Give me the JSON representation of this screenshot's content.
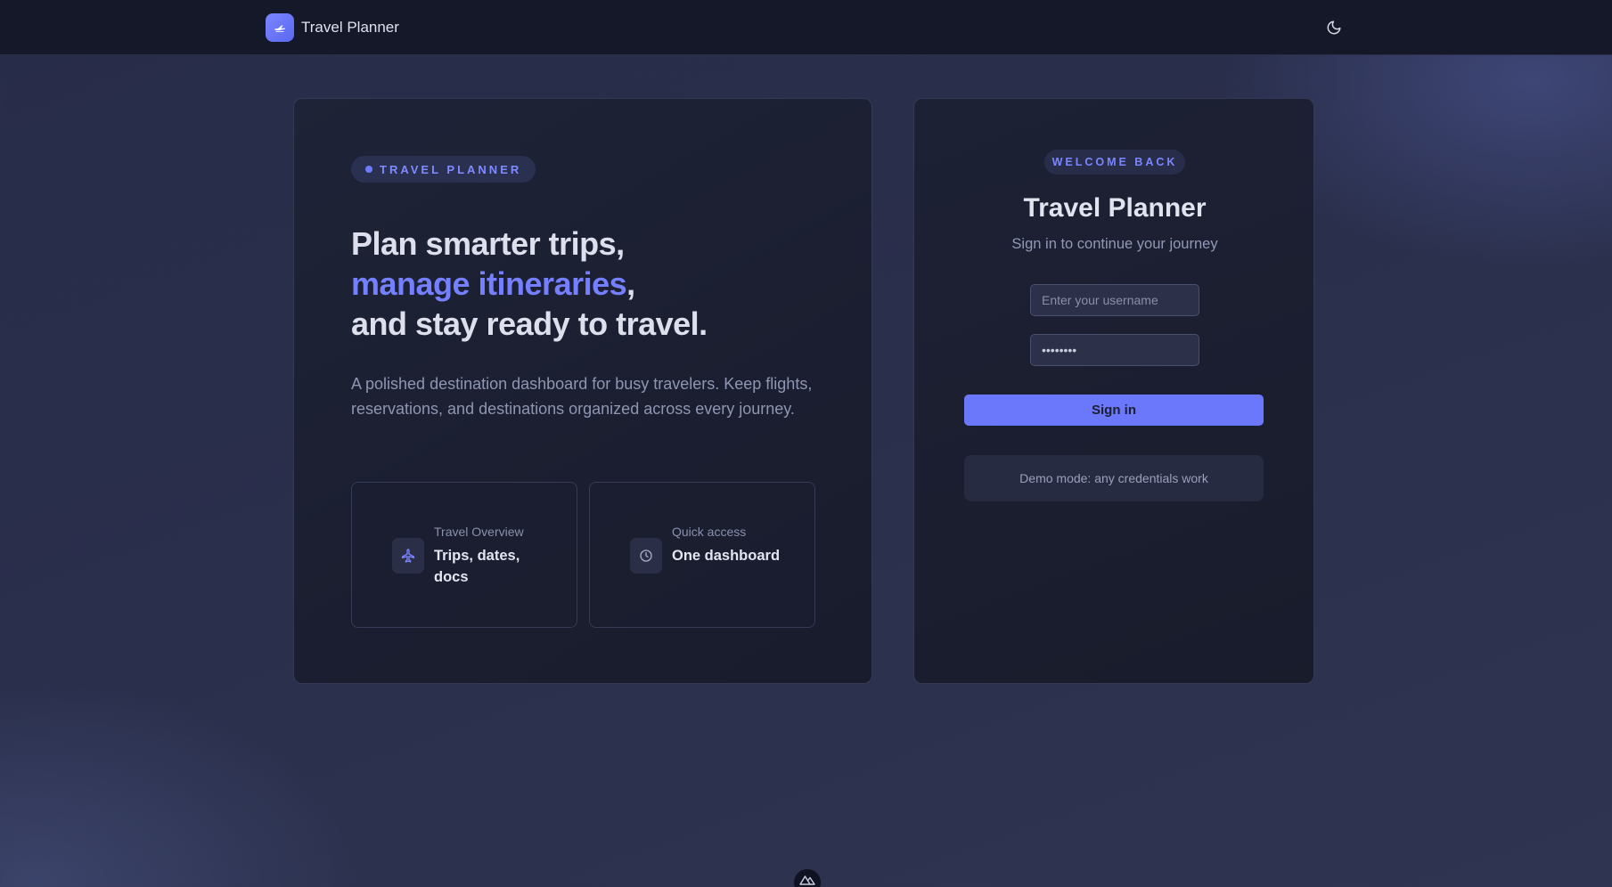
{
  "header": {
    "brand_name": "Travel Planner",
    "logo_icon": "plane-icon",
    "theme_icon": "moon-icon"
  },
  "hero": {
    "pill_label": "TRAVEL PLANNER",
    "headline_line1": "Plan smarter trips,",
    "headline_accent": "manage itineraries",
    "headline_comma": ",",
    "headline_line3": "and stay ready to travel.",
    "description": "A polished destination dashboard for busy travelers. Keep flights, reservations, and destinations organized across every journey.",
    "features": [
      {
        "caption": "Travel Overview",
        "title": "Trips, dates, docs",
        "icon": "plane-icon"
      },
      {
        "caption": "Quick access",
        "title": "One dashboard",
        "icon": "clock-icon"
      }
    ]
  },
  "signin": {
    "badge": "WELCOME BACK",
    "title": "Travel Planner",
    "subtitle": "Sign in to continue your journey",
    "username_placeholder": "Enter your username",
    "password_value": "••••••••",
    "button_label": "Sign in",
    "demo_note": "Demo mode: any credentials work"
  },
  "colors": {
    "accent": "#6b78fb",
    "header_bg": "#141828",
    "card_bg": "#1c2033"
  }
}
